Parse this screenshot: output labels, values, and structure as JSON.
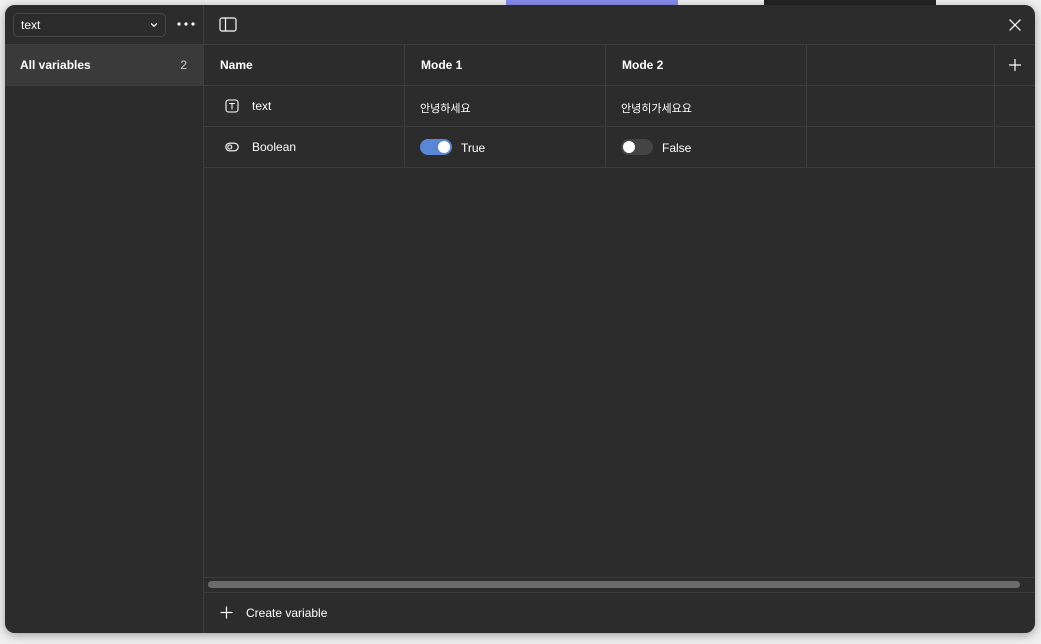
{
  "sidebar": {
    "collection_select": {
      "value": "text",
      "icon": "chevron-down-icon"
    },
    "more_icon": "more-horizontal-icon",
    "items": [
      {
        "label": "All variables",
        "count": "2",
        "active": true
      }
    ]
  },
  "header": {
    "panel_toggle_icon": "sidebar-toggle-icon",
    "close_icon": "close-icon"
  },
  "table": {
    "columns": [
      "Name",
      "Mode 1",
      "Mode 2"
    ],
    "add_mode_icon": "plus-icon",
    "rows": [
      {
        "type": "text",
        "icon": "text-type-icon",
        "name": "text",
        "mode1": "안녕하세요",
        "mode2": "안녕히가세요요"
      },
      {
        "type": "boolean",
        "icon": "boolean-type-icon",
        "name": "Boolean",
        "mode1": {
          "value": true,
          "label": "True"
        },
        "mode2": {
          "value": false,
          "label": "False"
        }
      }
    ]
  },
  "footer": {
    "create_label": "Create variable",
    "icon": "plus-icon"
  },
  "colors": {
    "background": "#2c2c2c",
    "selected": "#3a3a3a",
    "border": "#3d3d3d",
    "toggle_on": "#5a86d6",
    "toggle_off": "#444444",
    "text": "#ffffff"
  }
}
